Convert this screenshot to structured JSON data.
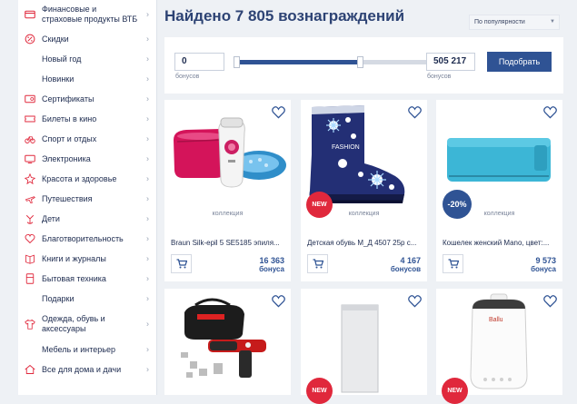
{
  "sidebar": {
    "items": [
      {
        "label": "Финансовые и страховые продукты ВТБ",
        "icon": "card-icon"
      },
      {
        "label": "Скидки",
        "icon": "percent-icon"
      },
      {
        "label": "Новый год",
        "icon": ""
      },
      {
        "label": "Новинки",
        "icon": ""
      },
      {
        "label": "Сертификаты",
        "icon": "certificate-icon"
      },
      {
        "label": "Билеты в кино",
        "icon": "ticket-icon"
      },
      {
        "label": "Спорт и отдых",
        "icon": "bicycle-icon"
      },
      {
        "label": "Электроника",
        "icon": "electronics-icon"
      },
      {
        "label": "Красота и здоровье",
        "icon": "beauty-icon"
      },
      {
        "label": "Путешествия",
        "icon": "travel-icon"
      },
      {
        "label": "Дети",
        "icon": "children-icon"
      },
      {
        "label": "Благотворительность",
        "icon": "charity-icon"
      },
      {
        "label": "Книги и журналы",
        "icon": "book-icon"
      },
      {
        "label": "Бытовая техника",
        "icon": "appliance-icon"
      },
      {
        "label": "Подарки",
        "icon": ""
      },
      {
        "label": "Одежда, обувь и аксессуары",
        "icon": "clothing-icon"
      },
      {
        "label": "Мебель и интерьер",
        "icon": ""
      },
      {
        "label": "Все для дома и дачи",
        "icon": "home-icon"
      }
    ],
    "chevron": "›",
    "accent_color": "#e0283c"
  },
  "header": {
    "title": "Найдено 7 805 вознаграждений",
    "sort_value": "По популярности"
  },
  "filter": {
    "min_value": "0",
    "max_value": "505 217",
    "min_label": "бонусов",
    "max_label": "бонусов",
    "range_start_fraction": 0.0,
    "range_end_fraction": 0.65,
    "apply_label": "Подобрать"
  },
  "products": [
    {
      "name": "Braun Silk-epil 5 SE5185 эпиля...",
      "collection": "коллекция",
      "price": "16 363",
      "bonus": "бонуса",
      "badge": ""
    },
    {
      "name": "Детская обувь М_Д 4507 25р с...",
      "collection": "коллекция",
      "price": "4 167",
      "bonus": "бонусов",
      "badge": "NEW"
    },
    {
      "name": "Кошелек женский Mano, цвет:...",
      "collection": "коллекция",
      "price": "9 573",
      "bonus": "бонуса",
      "badge": "-20%"
    },
    {
      "name": "",
      "collection": "",
      "price": "",
      "bonus": "",
      "badge": ""
    },
    {
      "name": "",
      "collection": "",
      "price": "",
      "bonus": "",
      "badge": "NEW"
    },
    {
      "name": "",
      "collection": "",
      "price": "",
      "bonus": "",
      "badge": "NEW"
    }
  ],
  "product_brand_text": "Ballu",
  "colors": {
    "brand_blue": "#2f5394",
    "badge_new": "#e0283c",
    "badge_discount": "#2f5394"
  }
}
